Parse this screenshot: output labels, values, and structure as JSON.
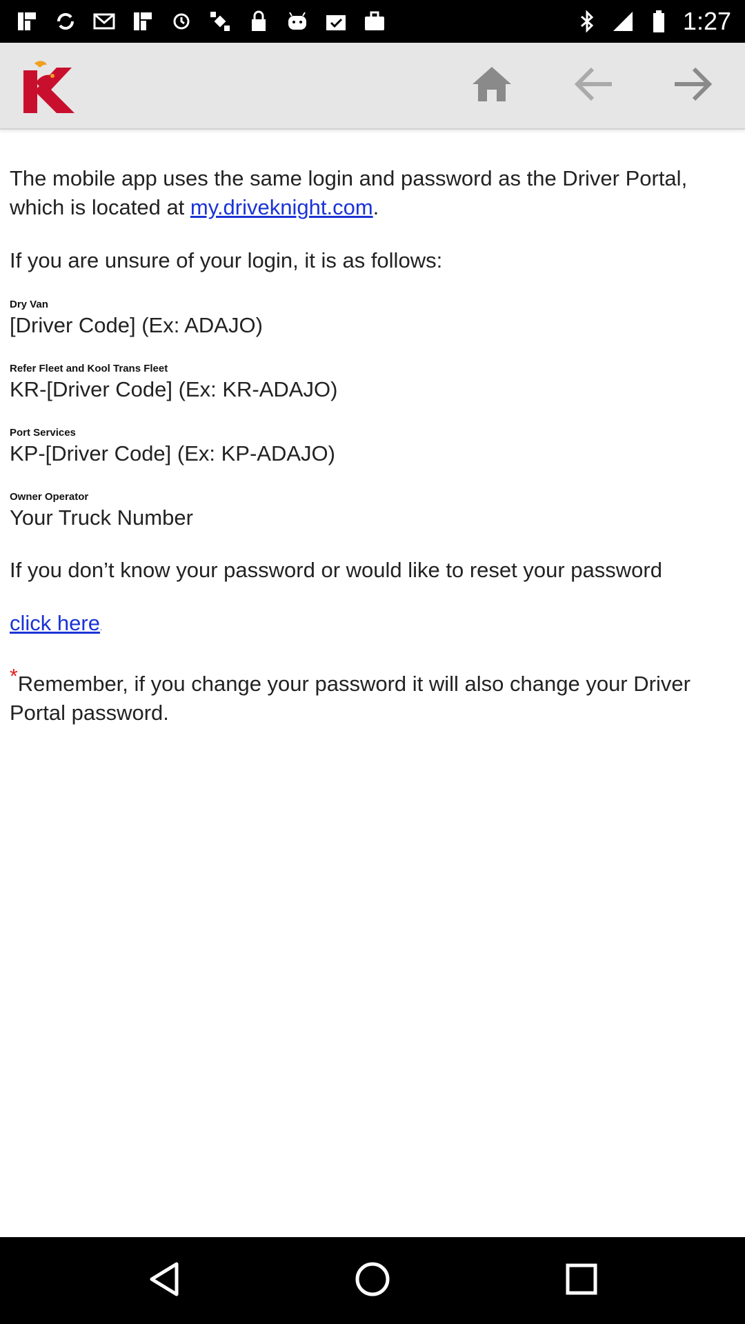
{
  "status_bar": {
    "time": "1:27",
    "left_icons": [
      "gallery-icon",
      "message-icon",
      "gallery-icon",
      "sync-icon",
      "satellite-icon",
      "lock-icon",
      "android-icon",
      "clipboard-check-icon",
      "bag-icon"
    ],
    "right_icons": [
      "bluetooth-icon",
      "signal-icon",
      "battery-icon"
    ]
  },
  "header": {
    "logo_icon": "knight-logo",
    "buttons": [
      "home-icon",
      "arrow-left-icon",
      "arrow-right-icon"
    ],
    "colors": {
      "logo_red": "#c8102e",
      "logo_orange": "#f0a020",
      "icon_gray": "#8a8a8a"
    }
  },
  "content": {
    "intro_before_link": "The mobile app uses the same login and password as the Driver Portal, which is located at ",
    "intro_link": "my.driveknight.com",
    "intro_after_link": ".",
    "unsure_text": "If you are unsure of your login, it is as follows:",
    "sections": [
      {
        "label": "Dry Van",
        "value": "[Driver Code] (Ex: ADAJO)"
      },
      {
        "label": "Refer Fleet and Kool Trans Fleet",
        "value": "KR-[Driver Code] (Ex: KR-ADAJO)"
      },
      {
        "label": "Port Services",
        "value": "KP-[Driver Code] (Ex: KP-ADAJO)"
      },
      {
        "label": "Owner Operator",
        "value": "Your Truck Number"
      }
    ],
    "reset_text": "If you don’t know your password or would like to reset your password",
    "click_here": "click here",
    "click_here_after": ".",
    "asterisk": "*",
    "remember_text": "Remember, if you change your password it will also change your Driver Portal password.",
    "link_color": "#1a33d6"
  },
  "nav_bar": {
    "buttons": [
      "back-triangle-icon",
      "home-circle-icon",
      "recent-square-icon"
    ]
  }
}
